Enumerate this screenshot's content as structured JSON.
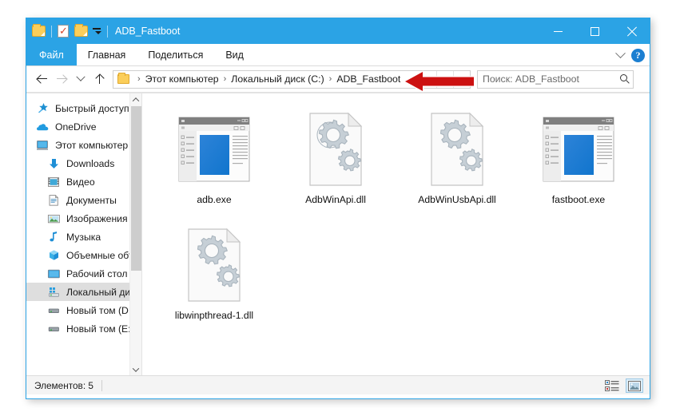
{
  "window": {
    "title": "ADB_Fastboot",
    "quick_access": [
      {
        "name": "folder-icon",
        "label": "Folder"
      },
      {
        "name": "properties-icon",
        "label": "Properties"
      },
      {
        "name": "new-folder-icon",
        "label": "New folder"
      }
    ],
    "controls": {
      "minimize": "—",
      "maximize": "□",
      "close": "✕"
    }
  },
  "ribbon": {
    "tabs": [
      {
        "label": "Файл",
        "active": true
      },
      {
        "label": "Главная",
        "active": false
      },
      {
        "label": "Поделиться",
        "active": false
      },
      {
        "label": "Вид",
        "active": false
      }
    ],
    "help_label": "?"
  },
  "address": {
    "back_title": "Назад",
    "forward_title": "Вперед",
    "recent_title": "Последние расположения",
    "up_title": "Вверх",
    "crumbs": [
      "Этот компьютер",
      "Локальный диск (C:)",
      "ADB_Fastboot"
    ],
    "separator": "›"
  },
  "search": {
    "placeholder": "Поиск: ADB_Fastboot",
    "value": ""
  },
  "sidebar": {
    "items": [
      {
        "label": "Быстрый доступ",
        "icon": "star-pin-icon",
        "indent": false,
        "selected": false
      },
      {
        "label": "OneDrive",
        "icon": "cloud-icon",
        "indent": false,
        "selected": false
      },
      {
        "label": "Этот компьютер",
        "icon": "monitor-icon",
        "indent": false,
        "selected": false
      },
      {
        "label": "Downloads",
        "icon": "download-arrow-icon",
        "indent": true,
        "selected": false
      },
      {
        "label": "Видео",
        "icon": "video-icon",
        "indent": true,
        "selected": false
      },
      {
        "label": "Документы",
        "icon": "document-icon",
        "indent": true,
        "selected": false
      },
      {
        "label": "Изображения",
        "icon": "picture-icon",
        "indent": true,
        "selected": false
      },
      {
        "label": "Музыка",
        "icon": "music-note-icon",
        "indent": true,
        "selected": false
      },
      {
        "label": "Объемные объ",
        "icon": "3d-objects-icon",
        "indent": true,
        "selected": false
      },
      {
        "label": "Рабочий стол",
        "icon": "desktop-icon",
        "indent": true,
        "selected": false
      },
      {
        "label": "Локальный дис",
        "icon": "local-disk-icon",
        "indent": true,
        "selected": true
      },
      {
        "label": "Новый том (D:)",
        "icon": "drive-icon",
        "indent": true,
        "selected": false
      },
      {
        "label": "Новый том (E:)",
        "icon": "drive-icon",
        "indent": true,
        "selected": false
      }
    ]
  },
  "files": [
    {
      "name": "adb.exe",
      "type": "exe"
    },
    {
      "name": "AdbWinApi.dll",
      "type": "dll"
    },
    {
      "name": "AdbWinUsbApi.dll",
      "type": "dll"
    },
    {
      "name": "fastboot.exe",
      "type": "exe"
    },
    {
      "name": "libwinpthread-1.dll",
      "type": "dll"
    }
  ],
  "status": {
    "items_text": "Элементов: 5",
    "view_details_title": "Крупные значки",
    "view_icons_title": "Таблица"
  },
  "annotation": {
    "arrow_color": "#CC1111",
    "arrow_outline": "#FFFFFF",
    "direction": "left",
    "points_to": "ADB_Fastboot"
  },
  "colors": {
    "titlebar": "#2BA3E5",
    "accent": "#2BA3E5",
    "selected_row": "#DEDEDE",
    "folder_yellow": "#FBCE5A"
  }
}
